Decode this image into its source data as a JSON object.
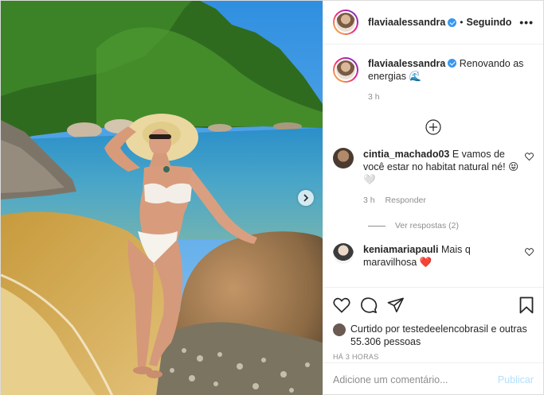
{
  "post": {
    "author": "flaviaalessandra",
    "follow_dot": "•",
    "follow_label": "Seguindo",
    "more_label": "•••"
  },
  "caption": {
    "author": "flaviaalessandra",
    "text": "Renovando as energias",
    "emoji": "🌊",
    "time": "3 h"
  },
  "comments": [
    {
      "author": "cintia_machado03",
      "text": "E vamos de você estar no habitat natural né!",
      "emoji": "😝🤍",
      "time": "3 h",
      "reply_label": "Responder",
      "view_replies": "Ver respostas (2)"
    },
    {
      "author": "keniamariapauli",
      "text": "Mais q maravilhosa",
      "emoji": "❤️"
    }
  ],
  "likes": {
    "prefix": "Curtido por",
    "user": "testedeelencobrasil",
    "connector": "e",
    "others": "outras 55.306 pessoas"
  },
  "timestamp": "HÁ 3 HORAS",
  "add_comment": {
    "placeholder": "Adicione um comentário...",
    "publish_label": "Publicar"
  },
  "colors": {
    "verified": "#3897f0",
    "publish_disabled": "#b2dffc",
    "secondary_text": "#8e8e8e"
  }
}
